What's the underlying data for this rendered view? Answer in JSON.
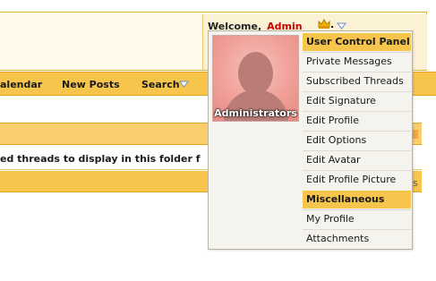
{
  "header": {
    "welcome_label": "Welcome,",
    "username": "Admin",
    "dot": "."
  },
  "navbar": {
    "items": [
      "alendar",
      "New Posts",
      "Search"
    ]
  },
  "content": {
    "message": "ed threads to display in this folder f",
    "strip_trailing_letter": "s"
  },
  "user_menu": {
    "avatar_caption": "Administrators",
    "items": [
      {
        "label": "User Control Panel",
        "type": "header"
      },
      {
        "label": "Private Messages",
        "type": "link"
      },
      {
        "label": "Subscribed Threads",
        "type": "link"
      },
      {
        "label": "Edit Signature",
        "type": "link"
      },
      {
        "label": "Edit Profile",
        "type": "link"
      },
      {
        "label": "Edit Options",
        "type": "link"
      },
      {
        "label": "Edit Avatar",
        "type": "link"
      },
      {
        "label": "Edit Profile Picture",
        "type": "link"
      },
      {
        "label": "Miscellaneous",
        "type": "header"
      },
      {
        "label": "My Profile",
        "type": "link"
      },
      {
        "label": "Attachments",
        "type": "link"
      }
    ]
  },
  "colors": {
    "accent": "#f7c44c",
    "username": "#cc0000"
  },
  "icons": {
    "crown": "crown-icon",
    "dropdown_caret": "chevron-down-icon"
  }
}
